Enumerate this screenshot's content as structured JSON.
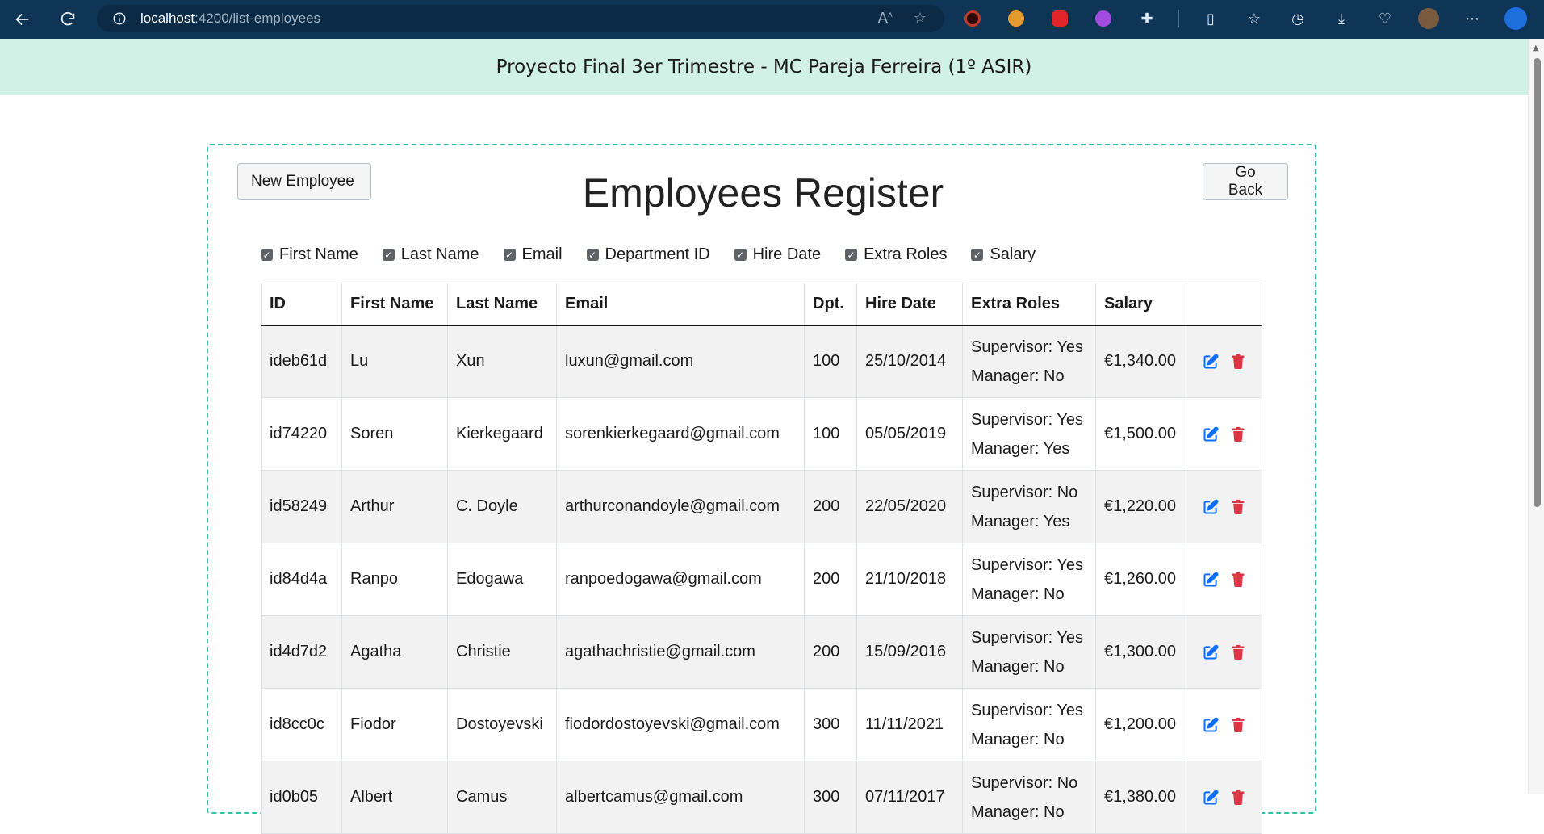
{
  "browser": {
    "url_host": "localhost",
    "url_path": ":4200/list-employees",
    "icons": [
      "back-icon",
      "refresh-icon",
      "info-icon",
      "read-aloud-icon",
      "favorite-star-icon"
    ]
  },
  "app": {
    "header": "Proyecto Final 3er Trimestre - MC Pareja Ferreira (1º ASIR)"
  },
  "page": {
    "title": "Employees Register",
    "new_button": "New Employee",
    "back_button": "Go Back"
  },
  "filters": [
    {
      "label": "First Name",
      "checked": true
    },
    {
      "label": "Last Name",
      "checked": true
    },
    {
      "label": "Email",
      "checked": true
    },
    {
      "label": "Department ID",
      "checked": true
    },
    {
      "label": "Hire Date",
      "checked": true
    },
    {
      "label": "Extra Roles",
      "checked": true
    },
    {
      "label": "Salary",
      "checked": true
    }
  ],
  "table": {
    "headers": [
      "ID",
      "First Name",
      "Last Name",
      "Email",
      "Dpt.",
      "Hire Date",
      "Extra Roles",
      "Salary",
      ""
    ],
    "rows": [
      {
        "id": "ideb61d",
        "first": "Lu",
        "last": "Xun",
        "email": "luxun@gmail.com",
        "dpt": "100",
        "hire": "25/10/2014",
        "supervisor": "Supervisor: Yes",
        "manager": "Manager: No",
        "salary": "€1,340.00"
      },
      {
        "id": "id74220",
        "first": "Soren",
        "last": "Kierkegaard",
        "email": "sorenkierkegaard@gmail.com",
        "dpt": "100",
        "hire": "05/05/2019",
        "supervisor": "Supervisor: Yes",
        "manager": "Manager: Yes",
        "salary": "€1,500.00"
      },
      {
        "id": "id58249",
        "first": "Arthur",
        "last": "C. Doyle",
        "email": "arthurconandoyle@gmail.com",
        "dpt": "200",
        "hire": "22/05/2020",
        "supervisor": "Supervisor: No",
        "manager": "Manager: Yes",
        "salary": "€1,220.00"
      },
      {
        "id": "id84d4a",
        "first": "Ranpo",
        "last": "Edogawa",
        "email": "ranpoedogawa@gmail.com",
        "dpt": "200",
        "hire": "21/10/2018",
        "supervisor": "Supervisor: Yes",
        "manager": "Manager: No",
        "salary": "€1,260.00"
      },
      {
        "id": "id4d7d2",
        "first": "Agatha",
        "last": "Christie",
        "email": "agathachristie@gmail.com",
        "dpt": "200",
        "hire": "15/09/2016",
        "supervisor": "Supervisor: Yes",
        "manager": "Manager: No",
        "salary": "€1,300.00"
      },
      {
        "id": "id8cc0c",
        "first": "Fiodor",
        "last": "Dostoyevski",
        "email": "fiodordostoyevski@gmail.com",
        "dpt": "300",
        "hire": "11/11/2021",
        "supervisor": "Supervisor: Yes",
        "manager": "Manager: No",
        "salary": "€1,200.00"
      },
      {
        "id": "id0b05",
        "first": "Albert",
        "last": "Camus",
        "email": "albertcamus@gmail.com",
        "dpt": "300",
        "hire": "07/11/2017",
        "supervisor": "Supervisor: No",
        "manager": "Manager: No",
        "salary": "€1,380.00"
      }
    ]
  },
  "colors": {
    "header_bg": "#d1f0e6",
    "card_border": "#2fc2a4",
    "edit_icon": "#0d6efd",
    "delete_icon": "#dc3545"
  }
}
